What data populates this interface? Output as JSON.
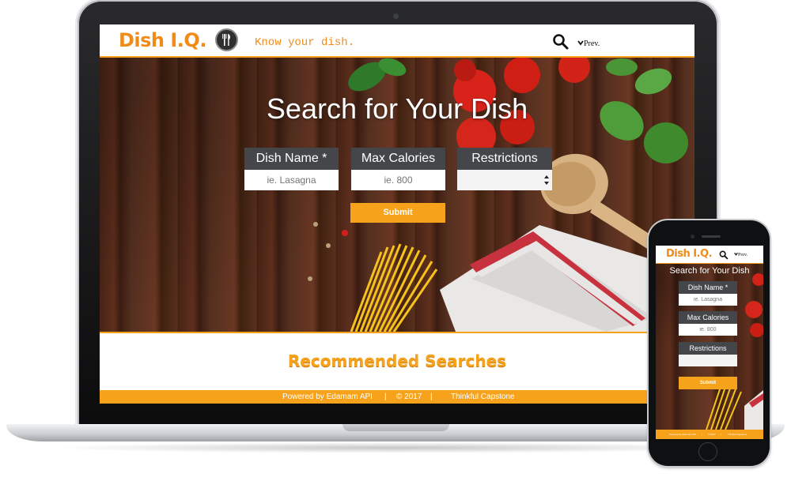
{
  "app": {
    "logo": "Dish I.Q.",
    "tagline": "Know your dish.",
    "prev_label": "Prev."
  },
  "hero": {
    "title": "Search for Your Dish"
  },
  "form": {
    "dish_name_label": "Dish Name *",
    "dish_name_placeholder": "ie. Lasagna",
    "max_calories_label": "Max Calories",
    "max_calories_placeholder": "ie. 800",
    "restrictions_label": "Restrictions",
    "restrictions_value": "",
    "submit_label": "Submit"
  },
  "recommended": {
    "title": "Recommended Searches"
  },
  "footer": {
    "powered_by": "Powered by Edamam API",
    "separator": "|",
    "copyright": "© 2017",
    "credit": "Thinkful Capstone"
  },
  "colors": {
    "accent": "#f7a21b",
    "logo": "#f08b1a",
    "label_bg": "#444649"
  },
  "icons": {
    "utensils": "fork-knife-icon",
    "search": "search-icon",
    "chevron": "chevron-down-icon"
  }
}
